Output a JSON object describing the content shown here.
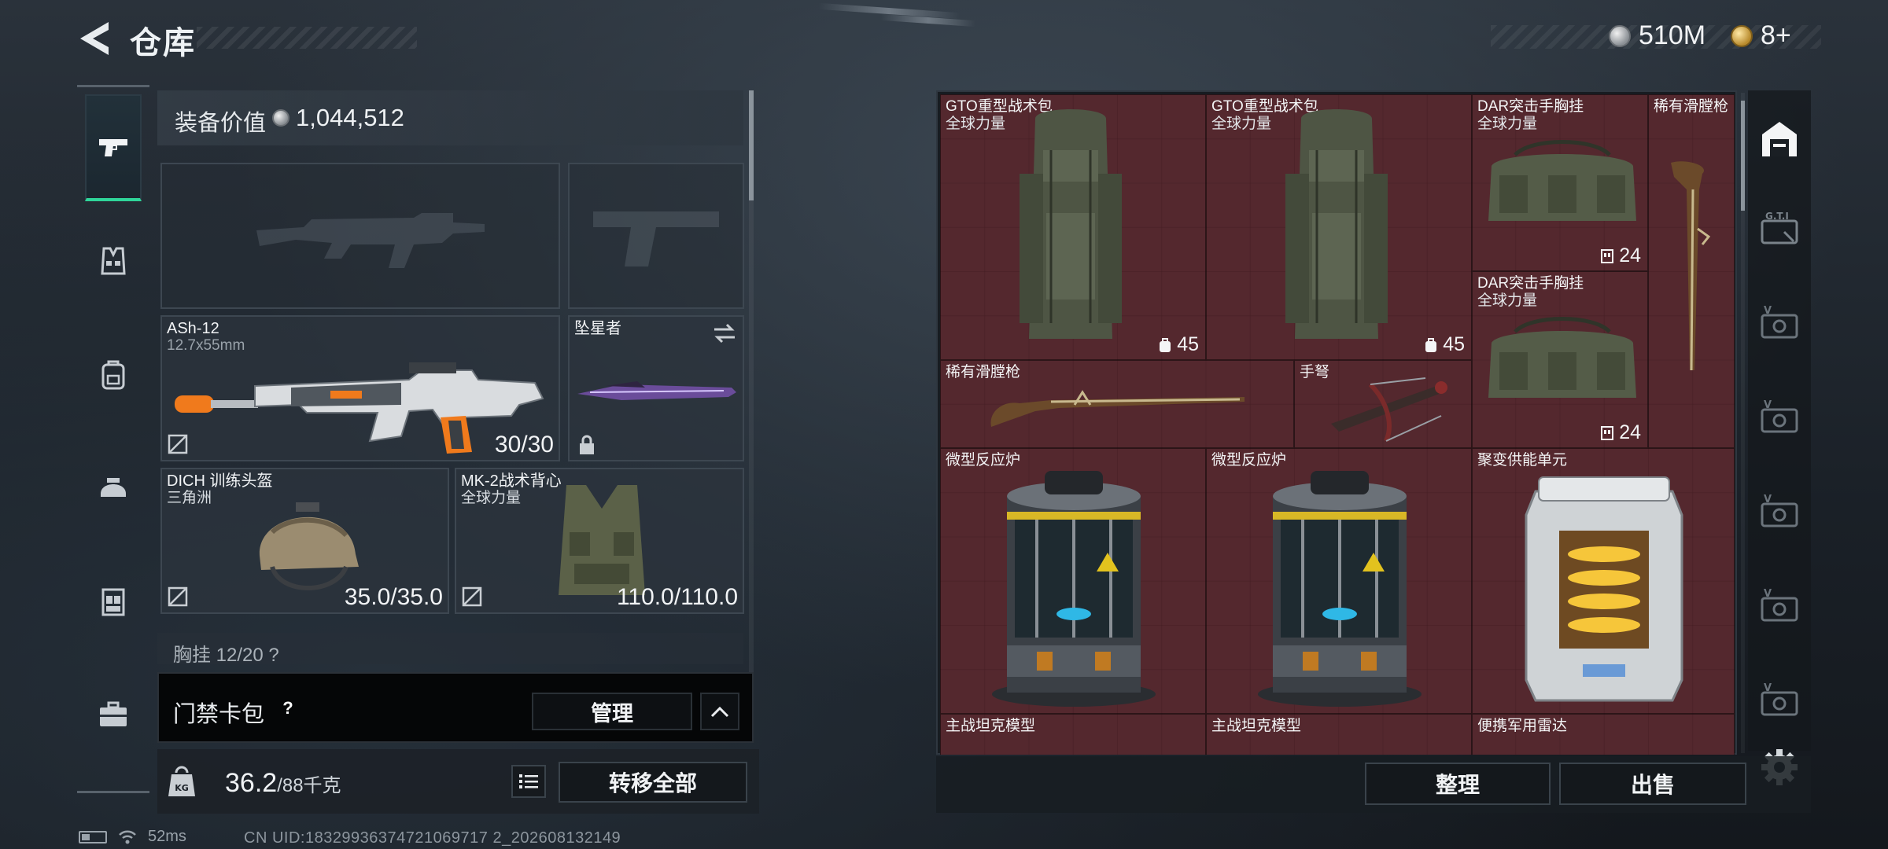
{
  "header": {
    "title": "仓库",
    "currency_silver": "510M",
    "currency_gold": "8+"
  },
  "rail": {
    "items": [
      {
        "name": "weapons",
        "icon": "pistol-icon",
        "active": true
      },
      {
        "name": "armor",
        "icon": "vest-icon",
        "active": false
      },
      {
        "name": "backpack",
        "icon": "backpack-icon",
        "active": false
      },
      {
        "name": "helmet",
        "icon": "helmet-icon",
        "active": false
      },
      {
        "name": "chest-rig",
        "icon": "rig-icon",
        "active": false
      },
      {
        "name": "case",
        "icon": "briefcase-icon",
        "active": false
      }
    ]
  },
  "loadout": {
    "value_label": "装备价值",
    "value_amount": "1,044,512",
    "primary": {
      "name": "ASh-12",
      "ammo": "12.7x55mm",
      "value": "30/30"
    },
    "melee": {
      "name": "坠星者"
    },
    "helmet": {
      "name": "DICH 训练头盔",
      "sub": "三角洲",
      "value": "35.0/35.0"
    },
    "armor": {
      "name": "MK-2战术背心",
      "sub": "全球力量",
      "value": "110.0/110.0"
    },
    "more_row": "胸挂 12/20 ?",
    "card_pack_label": "门禁卡包",
    "help": "?",
    "manage": "管理",
    "weight": "36.2",
    "weight_max": "/88千克",
    "transfer_all": "转移全部"
  },
  "status": {
    "ping": "52ms",
    "uid": "CN UID:18329936374721069717 2_202608132149"
  },
  "storage": {
    "items": [
      {
        "name": "GTO重型战术包",
        "sub": "全球力量",
        "count": "45",
        "kind": "backpack"
      },
      {
        "name": "GTO重型战术包",
        "sub": "全球力量",
        "count": "45",
        "kind": "backpack"
      },
      {
        "name": "DAR突击手胸挂",
        "sub": "全球力量",
        "count": "24",
        "kind": "rig"
      },
      {
        "name": "稀有滑膛枪",
        "sub": "",
        "count": "",
        "kind": "musket-v"
      },
      {
        "name": "DAR突击手胸挂",
        "sub": "全球力量",
        "count": "24",
        "kind": "rig"
      },
      {
        "name": "稀有滑膛枪",
        "sub": "",
        "count": "",
        "kind": "musket-h"
      },
      {
        "name": "手弩",
        "sub": "",
        "count": "",
        "kind": "crossbow"
      },
      {
        "name": "微型反应炉",
        "sub": "",
        "count": "",
        "kind": "reactor"
      },
      {
        "name": "微型反应炉",
        "sub": "",
        "count": "",
        "kind": "reactor"
      },
      {
        "name": "聚变供能单元",
        "sub": "",
        "count": "",
        "kind": "fusion"
      },
      {
        "name": "主战坦克模型",
        "sub": "",
        "count": "",
        "kind": "tank"
      },
      {
        "name": "主战坦克模型",
        "sub": "",
        "count": "",
        "kind": "tank"
      },
      {
        "name": "便携军用雷达",
        "sub": "",
        "count": "",
        "kind": "radar"
      }
    ],
    "sort": "整理",
    "sell": "出售"
  },
  "colors": {
    "accent_green": "#2fd59a",
    "grid_red": "#4a2a2f",
    "panel_dark": "#171c21"
  }
}
